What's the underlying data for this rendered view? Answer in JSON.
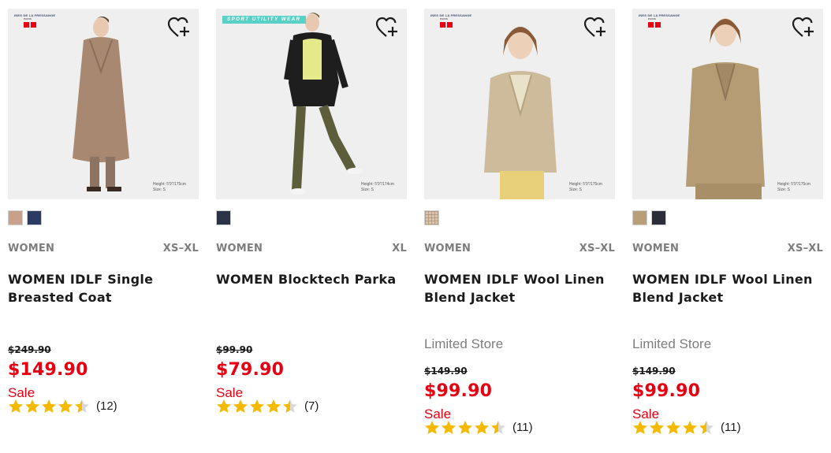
{
  "colors": {
    "sale_red": "#e60012",
    "star_gold": "#f5b900",
    "muted_gray": "#7d7d7d",
    "photo_bg": "#efefef",
    "sport_badge": "#5ad1c6"
  },
  "products": [
    {
      "badge": "idlf",
      "badge_text": "INES DE LA FRESSANGE",
      "badge_sub": "PARIS",
      "model_info": [
        "Height: 5'9\"/175cm",
        "Size: S"
      ],
      "favorite_icon": "heart-plus-icon",
      "swatches": [
        {
          "color": "#c9a08a",
          "label": "beige"
        },
        {
          "color": "#2c3b66",
          "label": "navy"
        }
      ],
      "gender": "WOMEN",
      "sizes": "XS–XL",
      "name": "WOMEN IDLF Single Breasted Coat",
      "store_note": "",
      "old_price": "$249.90",
      "price": "$149.90",
      "sale": "Sale",
      "rating": 4.5,
      "reviews": "(12)"
    },
    {
      "badge": "sport",
      "badge_text": "SPORT UTILITY WEAR",
      "model_info": [
        "Height: 5'9\"/174cm",
        "Size: S"
      ],
      "favorite_icon": "heart-plus-icon",
      "swatches": [
        {
          "color": "#2b3347",
          "label": "navy"
        }
      ],
      "gender": "WOMEN",
      "sizes": "XL",
      "name": "WOMEN Blocktech Parka",
      "store_note": "",
      "old_price": "$99.90",
      "price": "$79.90",
      "sale": "Sale",
      "rating": 4.5,
      "reviews": "(7)"
    },
    {
      "badge": "idlf",
      "badge_text": "INES DE LA FRESSANGE",
      "badge_sub": "PARIS",
      "model_info": [
        "Height: 5'9\"/175cm",
        "Size: S"
      ],
      "favorite_icon": "heart-plus-icon",
      "swatches": [
        {
          "color": "#d9c3aa",
          "label": "check",
          "pattern": true
        }
      ],
      "gender": "WOMEN",
      "sizes": "XS–XL",
      "name": "WOMEN IDLF Wool Linen Blend Jacket",
      "store_note": "Limited Store",
      "old_price": "$149.90",
      "price": "$99.90",
      "sale": "Sale",
      "rating": 4.5,
      "reviews": "(11)"
    },
    {
      "badge": "idlf",
      "badge_text": "INES DE LA FRESSANGE",
      "badge_sub": "PARIS",
      "model_info": [
        "Height: 5'9\"/175cm",
        "Size: S"
      ],
      "favorite_icon": "heart-plus-icon",
      "swatches": [
        {
          "color": "#b89f78",
          "label": "beige"
        },
        {
          "color": "#2b2e38",
          "label": "dark navy"
        }
      ],
      "gender": "WOMEN",
      "sizes": "XS–XL",
      "name": "WOMEN IDLF Wool Linen Blend Jacket",
      "store_note": "Limited Store",
      "old_price": "$149.90",
      "price": "$99.90",
      "sale": "Sale",
      "rating": 4.5,
      "reviews": "(11)"
    }
  ]
}
